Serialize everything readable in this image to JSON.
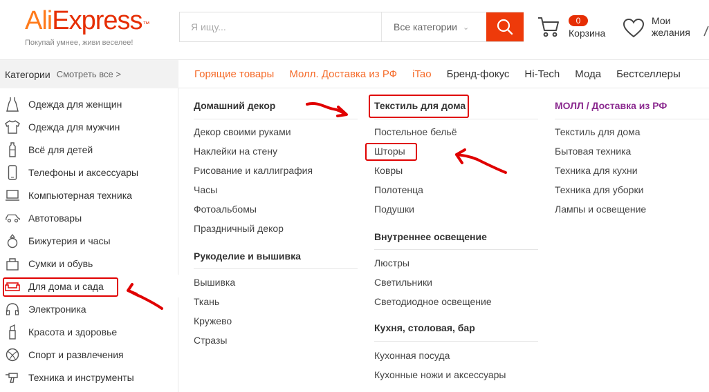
{
  "header": {
    "logo_ali": "Ali",
    "logo_express": "Express",
    "logo_tm": "™",
    "tagline": "Покупай умнее, живи веселее!",
    "search": {
      "placeholder": "Я ищу...",
      "category": "Все категории"
    },
    "cart": {
      "count": "0",
      "label": "Корзина"
    },
    "wishlist": {
      "label": "Мои желания"
    }
  },
  "navbar": {
    "categories_title": "Категории",
    "see_all": "Смотреть все >",
    "links": [
      {
        "label": "Горящие товары",
        "hot": true
      },
      {
        "label": "Молл. Доставка из РФ",
        "hot": true
      },
      {
        "label": "iTao",
        "hot": true
      },
      {
        "label": "Бренд-фокус",
        "hot": false
      },
      {
        "label": "Hi-Tech",
        "hot": false
      },
      {
        "label": "Мода",
        "hot": false
      },
      {
        "label": "Бестселлеры",
        "hot": false
      }
    ]
  },
  "sidebar": {
    "items": [
      {
        "label": "Одежда для женщин",
        "icon": "dress-icon"
      },
      {
        "label": "Одежда для мужчин",
        "icon": "shirt-icon"
      },
      {
        "label": "Всё для детей",
        "icon": "bottle-icon"
      },
      {
        "label": "Телефоны и аксессуары",
        "icon": "phone-icon"
      },
      {
        "label": "Компьютерная техника",
        "icon": "laptop-icon"
      },
      {
        "label": "Автотовары",
        "icon": "car-icon"
      },
      {
        "label": "Бижутерия и часы",
        "icon": "ring-icon"
      },
      {
        "label": "Сумки и обувь",
        "icon": "bag-icon"
      },
      {
        "label": "Для дома и сада",
        "icon": "sofa-icon",
        "active": true
      },
      {
        "label": "Электроника",
        "icon": "headphones-icon"
      },
      {
        "label": "Красота и здоровье",
        "icon": "lipstick-icon"
      },
      {
        "label": "Спорт и развлечения",
        "icon": "ball-icon"
      },
      {
        "label": "Техника и инструменты",
        "icon": "drill-icon"
      }
    ]
  },
  "menu": {
    "col1": {
      "groups": [
        {
          "title": "Домашний декор",
          "items": [
            "Декор своими руками",
            "Наклейки на стену",
            "Рисование и каллиграфия",
            "Часы",
            "Фотоальбомы",
            "Праздничный декор"
          ]
        },
        {
          "title": "Рукоделие и вышивка",
          "items": [
            "Вышивка",
            "Ткань",
            "Кружево",
            "Стразы"
          ]
        }
      ]
    },
    "col2": {
      "groups": [
        {
          "title": "Текстиль для дома",
          "items": [
            "Постельное бельё",
            "Шторы",
            "Ковры",
            "Полотенца",
            "Подушки"
          ]
        },
        {
          "title": "Внутреннее освещение",
          "items": [
            "Люстры",
            "Светильники",
            "Светодиодное освещение"
          ]
        },
        {
          "title": "Кухня, столовая, бар",
          "items": [
            "Кухонная посуда",
            "Кухонные ножи и аксессуары"
          ]
        }
      ]
    },
    "col3": {
      "groups": [
        {
          "title": "МОЛЛ / Доставка из РФ",
          "items": [
            "Текстиль для дома",
            "Бытовая техника",
            "Техника для кухни",
            "Техника для уборки",
            "Лампы и освещение"
          ]
        }
      ]
    }
  },
  "colors": {
    "brand_orange": "#ff7a1a",
    "brand_red": "#e62e04",
    "search_button": "#ee3a0a",
    "mall_purple": "#8b2a8f",
    "annotation_red": "#e00000"
  }
}
